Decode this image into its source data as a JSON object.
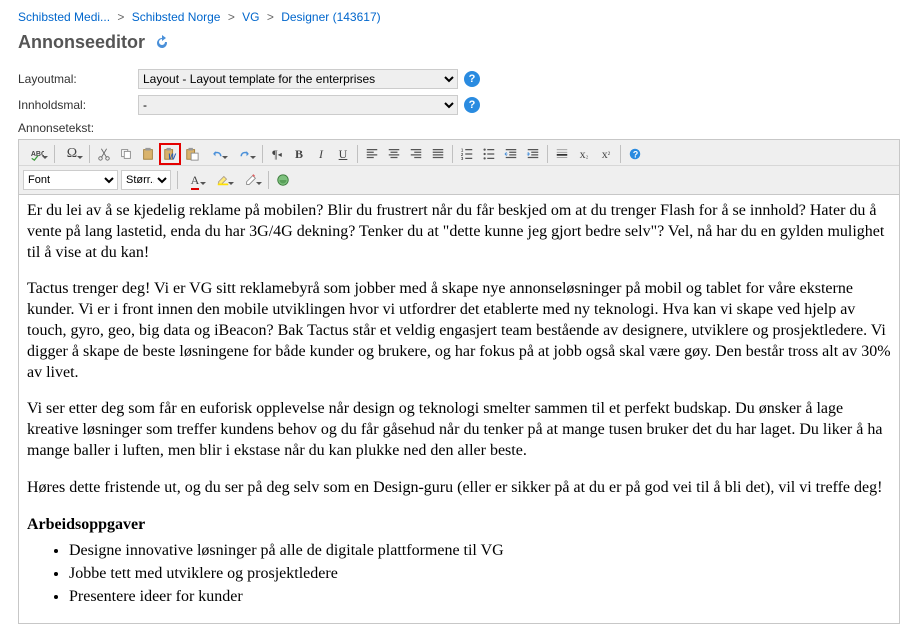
{
  "breadcrumb": {
    "items": [
      "Schibsted Medi...",
      "Schibsted Norge",
      "VG",
      "Designer (143617)"
    ]
  },
  "title": "Annonseeditor",
  "form": {
    "layout_label": "Layoutmal:",
    "layout_value": "Layout - Layout template for the enterprises",
    "content_label": "Innholdsmal:",
    "content_value": "-",
    "adtext_label": "Annonsetekst:"
  },
  "toolbar": {
    "font_label": "Font",
    "size_label": "Størr..."
  },
  "icons": {
    "help": "?"
  },
  "content": {
    "p1": "Er du lei av å se kjedelig reklame på mobilen? Blir du frustrert når du får beskjed om at du trenger Flash for å se innhold? Hater du å vente på lang lastetid, enda du har 3G/4G dekning? Tenker du at \"dette kunne jeg gjort bedre selv\"? Vel, nå har du en gylden mulighet til å vise at du kan!",
    "p2": "Tactus trenger deg! Vi er VG sitt reklamebyrå som jobber med å skape nye annonseløsninger på mobil og tablet for våre eksterne kunder. Vi er i front innen den mobile utviklingen hvor vi utfordrer det etablerte med ny teknologi. Hva kan vi skape ved hjelp av touch, gyro, geo, big data og iBeacon? Bak Tactus står et veldig engasjert team bestående av designere, utviklere og prosjektledere. Vi digger å skape de beste løsningene for både kunder og brukere, og har fokus på at jobb også skal være gøy. Den består tross alt av 30% av livet.",
    "p3": "Vi ser etter deg som får en euforisk opplevelse når design og teknologi smelter sammen til et perfekt budskap. Du ønsker å lage kreative løsninger som treffer kundens behov og du får gåsehud når du tenker på at mange tusen bruker det du har laget. Du liker å ha mange baller i luften, men blir i ekstase når du kan plukke ned den aller beste.",
    "p4": "Høres dette fristende ut, og du ser på deg selv som en Design-guru (eller er sikker på at du er på god vei til å bli det), vil vi treffe deg!",
    "tasks_heading": "Arbeidsoppgaver",
    "tasks": [
      "Designe innovative løsninger på alle de digitale plattformene til VG",
      "Jobbe tett med utviklere og prosjektledere",
      "Presentere ideer for kunder"
    ]
  }
}
